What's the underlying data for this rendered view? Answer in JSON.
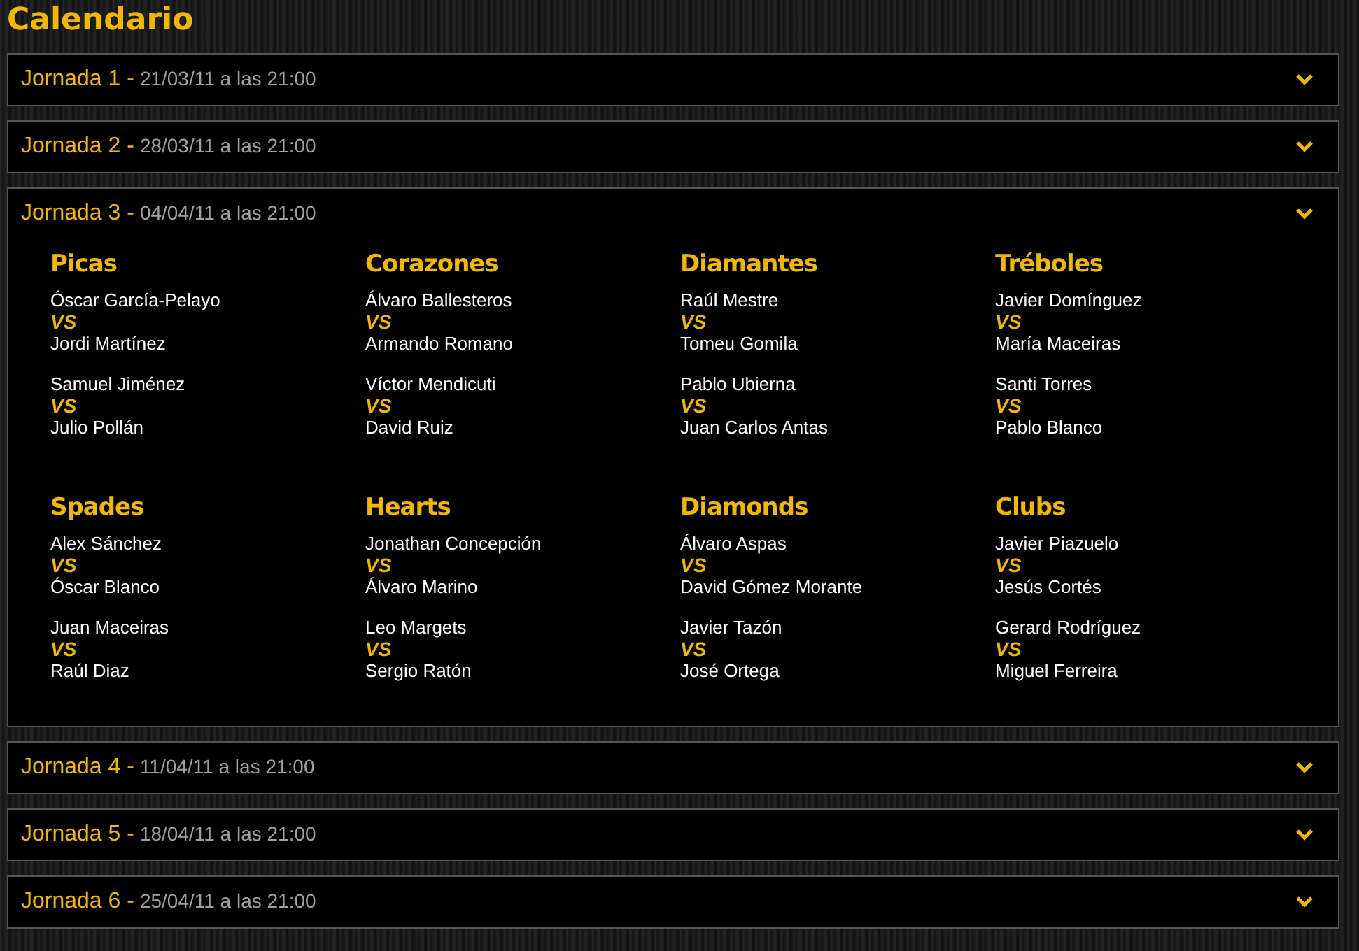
{
  "title": "Calendario",
  "rounds": [
    {
      "label": "Jornada 1 -",
      "date": "21/03/11 a las 21:00",
      "expanded": false
    },
    {
      "label": "Jornada 2 -",
      "date": "28/03/11 a las 21:00",
      "expanded": false
    },
    {
      "label": "Jornada 3 -",
      "date": "04/04/11 a las 21:00",
      "expanded": true,
      "groups": [
        {
          "title": "Picas",
          "matches": [
            {
              "home": "Óscar García-Pelayo",
              "vs": "VS",
              "away": "Jordi Martínez"
            },
            {
              "home": "Samuel Jiménez",
              "vs": "VS",
              "away": "Julio Pollán"
            }
          ]
        },
        {
          "title": "Corazones",
          "matches": [
            {
              "home": "Álvaro Ballesteros",
              "vs": "VS",
              "away": "Armando Romano"
            },
            {
              "home": "Víctor Mendicuti",
              "vs": "VS",
              "away": "David Ruiz"
            }
          ]
        },
        {
          "title": "Diamantes",
          "matches": [
            {
              "home": "Raúl Mestre",
              "vs": "VS",
              "away": "Tomeu Gomila"
            },
            {
              "home": "Pablo Ubierna",
              "vs": "VS",
              "away": "Juan Carlos Antas"
            }
          ]
        },
        {
          "title": "Tréboles",
          "matches": [
            {
              "home": "Javier Domínguez",
              "vs": "VS",
              "away": "María Maceiras"
            },
            {
              "home": "Santi Torres",
              "vs": "VS",
              "away": "Pablo Blanco"
            }
          ]
        },
        {
          "title": "Spades",
          "matches": [
            {
              "home": "Alex Sánchez",
              "vs": "VS",
              "away": "Óscar Blanco"
            },
            {
              "home": "Juan Maceiras",
              "vs": "VS",
              "away": "Raúl Diaz"
            }
          ]
        },
        {
          "title": "Hearts",
          "matches": [
            {
              "home": "Jonathan Concepción",
              "vs": "VS",
              "away": "Álvaro Marino"
            },
            {
              "home": "Leo Margets",
              "vs": "VS",
              "away": "Sergio Ratón"
            }
          ]
        },
        {
          "title": "Diamonds",
          "matches": [
            {
              "home": "Álvaro Aspas",
              "vs": "VS",
              "away": "David Gómez Morante"
            },
            {
              "home": "Javier Tazón",
              "vs": "VS",
              "away": "José Ortega"
            }
          ]
        },
        {
          "title": "Clubs",
          "matches": [
            {
              "home": "Javier Piazuelo",
              "vs": "VS",
              "away": "Jesús Cortés"
            },
            {
              "home": "Gerard Rodríguez",
              "vs": "VS",
              "away": "Miguel Ferreira"
            }
          ]
        }
      ]
    },
    {
      "label": "Jornada 4 -",
      "date": "11/04/11 a las 21:00",
      "expanded": false
    },
    {
      "label": "Jornada 5 -",
      "date": "18/04/11 a las 21:00",
      "expanded": false
    },
    {
      "label": "Jornada 6 -",
      "date": "25/04/11 a las 21:00",
      "expanded": false
    }
  ]
}
